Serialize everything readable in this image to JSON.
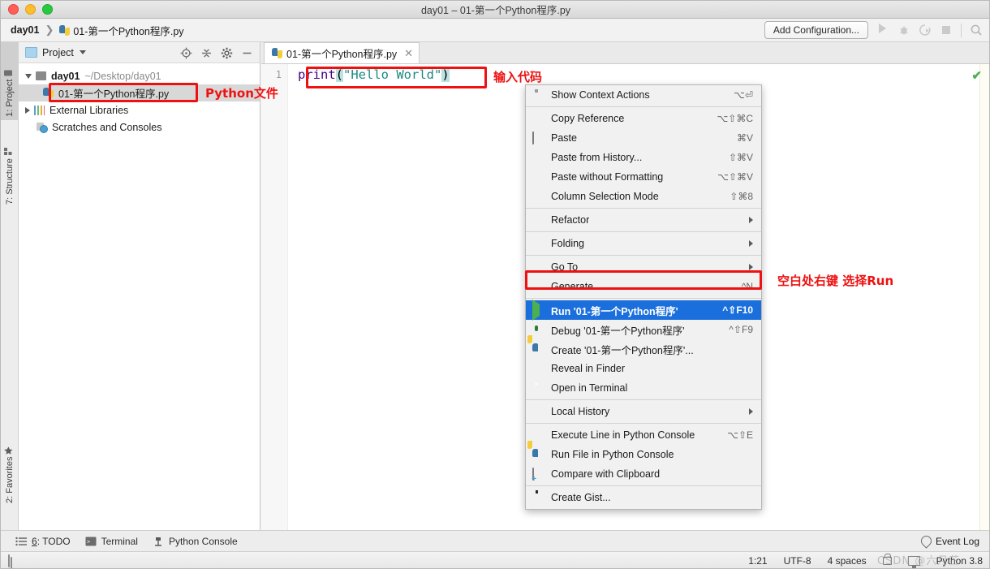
{
  "window": {
    "title": "day01 – 01-第一个Python程序.py"
  },
  "navbar": {
    "breadcrumb_project": "day01",
    "breadcrumb_sep": "❯",
    "breadcrumb_file": "01-第一个Python程序.py",
    "add_configuration_label": "Add Configuration...",
    "icons": [
      "run-icon",
      "debug-icon",
      "run-coverage-icon",
      "stop-icon",
      "search-icon"
    ]
  },
  "left_tool_strip": {
    "tabs": [
      {
        "label": "1: Project",
        "icon": "project-icon",
        "active": true
      },
      {
        "label": "7: Structure",
        "icon": "structure-icon",
        "active": false
      },
      {
        "label": "2: Favorites",
        "icon": "star-icon",
        "active": false
      }
    ]
  },
  "project_panel": {
    "header_title": "Project",
    "header_icons": [
      "locate-icon",
      "collapse-all-icon",
      "settings-gear-icon",
      "hide-icon"
    ],
    "tree": [
      {
        "label": "day01",
        "path": "~/Desktop/day01",
        "icon": "folder-icon",
        "expanded": true,
        "bold": true,
        "indent": 0,
        "selected": false
      },
      {
        "label": "01-第一个Python程序.py",
        "path": "",
        "icon": "python-file-icon",
        "expanded": null,
        "bold": false,
        "indent": 1,
        "selected": true
      },
      {
        "label": "External Libraries",
        "path": "",
        "icon": "libraries-icon",
        "expanded": false,
        "bold": false,
        "indent": 0,
        "selected": false
      },
      {
        "label": "Scratches and Consoles",
        "path": "",
        "icon": "scratches-icon",
        "expanded": null,
        "bold": false,
        "indent": 0,
        "selected": false
      }
    ]
  },
  "editor": {
    "tab_label": "01-第一个Python程序.py",
    "tab_close": "✕",
    "line_numbers": [
      "1"
    ],
    "code": {
      "fn": "print",
      "open_paren": "(",
      "string": "\"Hello World\"",
      "close_paren": ")"
    },
    "inspection_status": "✔"
  },
  "annotations": [
    {
      "text": "Python文件",
      "color": "#ee1111"
    },
    {
      "text": "输入代码",
      "color": "#ee1111"
    },
    {
      "text": "空白处右键 选择Run",
      "color": "#ee1111"
    }
  ],
  "context_menu": {
    "items": [
      {
        "icon": "lightbulb-icon",
        "label": "Show Context Actions",
        "shortcut": "⌥⏎",
        "submenu": false,
        "selected": false,
        "sep_after": true
      },
      {
        "icon": "",
        "label": "Copy Reference",
        "shortcut": "⌥⇧⌘C",
        "submenu": false,
        "selected": false,
        "sep_after": false
      },
      {
        "icon": "clipboard-icon",
        "label": "Paste",
        "shortcut": "⌘V",
        "submenu": false,
        "selected": false,
        "sep_after": false
      },
      {
        "icon": "",
        "label": "Paste from History...",
        "shortcut": "⇧⌘V",
        "submenu": false,
        "selected": false,
        "sep_after": false
      },
      {
        "icon": "",
        "label": "Paste without Formatting",
        "shortcut": "⌥⇧⌘V",
        "submenu": false,
        "selected": false,
        "sep_after": false
      },
      {
        "icon": "",
        "label": "Column Selection Mode",
        "shortcut": "⇧⌘8",
        "submenu": false,
        "selected": false,
        "sep_after": true
      },
      {
        "icon": "",
        "label": "Refactor",
        "shortcut": "",
        "submenu": true,
        "selected": false,
        "sep_after": true
      },
      {
        "icon": "",
        "label": "Folding",
        "shortcut": "",
        "submenu": true,
        "selected": false,
        "sep_after": true
      },
      {
        "icon": "",
        "label": "Go To",
        "shortcut": "",
        "submenu": true,
        "selected": false,
        "sep_after": false
      },
      {
        "icon": "",
        "label": "Generate...",
        "shortcut": "^N",
        "submenu": false,
        "selected": false,
        "sep_after": true
      },
      {
        "icon": "run-triangle-icon",
        "label": "Run '01-第一个Python程序'",
        "shortcut": "^⇧F10",
        "submenu": false,
        "selected": true,
        "sep_after": false
      },
      {
        "icon": "debug-bug-icon",
        "label": "Debug '01-第一个Python程序'",
        "shortcut": "^⇧F9",
        "submenu": false,
        "selected": false,
        "sep_after": false
      },
      {
        "icon": "python-icon",
        "label": "Create '01-第一个Python程序'...",
        "shortcut": "",
        "submenu": false,
        "selected": false,
        "sep_after": false
      },
      {
        "icon": "",
        "label": "Reveal in Finder",
        "shortcut": "",
        "submenu": false,
        "selected": false,
        "sep_after": false
      },
      {
        "icon": "terminal-icon",
        "label": "Open in Terminal",
        "shortcut": "",
        "submenu": false,
        "selected": false,
        "sep_after": true
      },
      {
        "icon": "",
        "label": "Local History",
        "shortcut": "",
        "submenu": true,
        "selected": false,
        "sep_after": true
      },
      {
        "icon": "",
        "label": "Execute Line in Python Console",
        "shortcut": "⌥⇧E",
        "submenu": false,
        "selected": false,
        "sep_after": false
      },
      {
        "icon": "python-icon",
        "label": "Run File in Python Console",
        "shortcut": "",
        "submenu": false,
        "selected": false,
        "sep_after": false
      },
      {
        "icon": "compare-icon",
        "label": "Compare with Clipboard",
        "shortcut": "",
        "submenu": false,
        "selected": false,
        "sep_after": true
      },
      {
        "icon": "github-icon",
        "label": "Create Gist...",
        "shortcut": "",
        "submenu": false,
        "selected": false,
        "sep_after": false
      }
    ]
  },
  "bottom_bar": {
    "items": [
      {
        "icon": "todo-icon",
        "num": "6",
        "label": ": TODO"
      },
      {
        "icon": "terminal-icon",
        "num": "",
        "label": "Terminal"
      },
      {
        "icon": "python-console-icon",
        "num": "",
        "label": "Python Console"
      }
    ],
    "event_log": "Event Log"
  },
  "status_bar": {
    "caret_position": "1:21",
    "encoding": "UTF-8",
    "indent": "4 spaces",
    "lock_icon": "lock-icon",
    "screen_icon": "screen-icon",
    "interpreter": "Python 3.8"
  },
  "watermark": "CSDN @六月芷"
}
